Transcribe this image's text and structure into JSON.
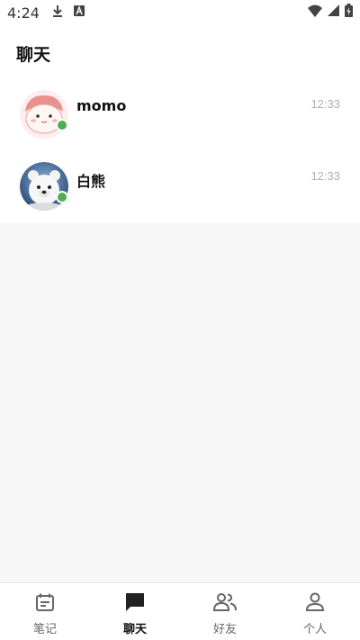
{
  "status_bar": {
    "time": "4:24",
    "left_icons": [
      "download-icon",
      "font-icon"
    ],
    "right_icons": [
      "wifi-icon",
      "signal-icon",
      "battery-icon"
    ]
  },
  "header": {
    "title": "聊天"
  },
  "chats": [
    {
      "name": "momo",
      "time": "12:33",
      "online": true,
      "avatar": "pink-cartoon-avatar"
    },
    {
      "name": "白熊",
      "time": "12:33",
      "online": true,
      "avatar": "polar-bear-avatar"
    }
  ],
  "bottom_nav": {
    "items": [
      {
        "label": "笔记",
        "icon": "notebook-icon",
        "active": false
      },
      {
        "label": "聊天",
        "icon": "chat-icon",
        "active": true
      },
      {
        "label": "好友",
        "icon": "friends-icon",
        "active": false
      },
      {
        "label": "个人",
        "icon": "person-icon",
        "active": false
      }
    ]
  },
  "colors": {
    "online": "#4caf50",
    "timestamp": "#b0b0b0",
    "background": "#f7f7f7"
  }
}
